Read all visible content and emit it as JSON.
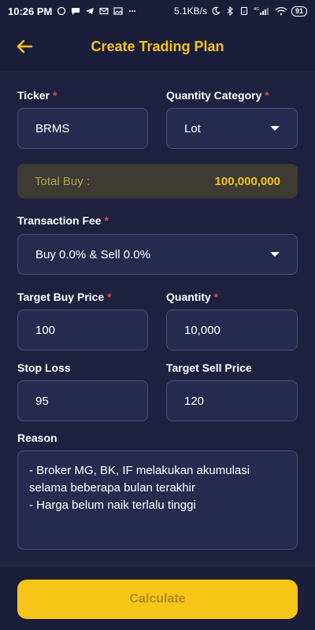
{
  "status_bar": {
    "time": "10:26 PM",
    "speed": "5.1KB/s",
    "battery": "91",
    "network": "4G"
  },
  "header": {
    "title": "Create Trading Plan",
    "back_icon": "arrow-left-icon"
  },
  "form": {
    "ticker": {
      "label": "Ticker",
      "required": "*",
      "value": "BRMS"
    },
    "quantity_category": {
      "label": "Quantity Category",
      "required": "*",
      "value": "Lot"
    },
    "total_buy": {
      "label": "Total Buy :",
      "value": "100,000,000"
    },
    "transaction_fee": {
      "label": "Transaction Fee",
      "required": "*",
      "value": "Buy 0.0% & Sell 0.0%"
    },
    "target_buy_price": {
      "label": "Target Buy Price",
      "required": "*",
      "value": "100"
    },
    "quantity": {
      "label": "Quantity",
      "required": "*",
      "value": "10,000"
    },
    "stop_loss": {
      "label": "Stop Loss",
      "value": "95"
    },
    "target_sell_price": {
      "label": "Target Sell Price",
      "value": "120"
    },
    "reason": {
      "label": "Reason",
      "line1": "- Broker MG, BK, IF melakukan akumulasi",
      "line2": "selama beberapa bulan terakhir",
      "line3": "- Harga belum naik terlalu tinggi"
    }
  },
  "actions": {
    "calculate_label": "Calculate"
  },
  "colors": {
    "background": "#1e2140",
    "accent": "#f5c518",
    "required": "#e84a4a",
    "field_bg": "#272b4f"
  }
}
